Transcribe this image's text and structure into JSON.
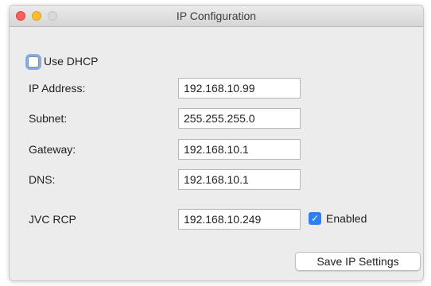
{
  "window": {
    "title": "IP Configuration"
  },
  "dhcp": {
    "label": "Use DHCP",
    "checked": false
  },
  "fields": {
    "ip_address": {
      "label": "IP Address:",
      "value": "192.168.10.99"
    },
    "subnet": {
      "label": "Subnet:",
      "value": "255.255.255.0"
    },
    "gateway": {
      "label": "Gateway:",
      "value": "192.168.10.1"
    },
    "dns": {
      "label": "DNS:",
      "value": "192.168.10.1"
    },
    "jvc_rcp": {
      "label": "JVC RCP",
      "value": "192.168.10.249"
    }
  },
  "rcp_enabled": {
    "label": "Enabled",
    "checked": true,
    "check_glyph": "✓"
  },
  "buttons": {
    "save": "Save IP Settings"
  },
  "colors": {
    "accent": "#2f7ff6",
    "close": "#fc5f57",
    "minimize": "#fdbc2e",
    "maximize_disabled": "#d9d9d9"
  }
}
